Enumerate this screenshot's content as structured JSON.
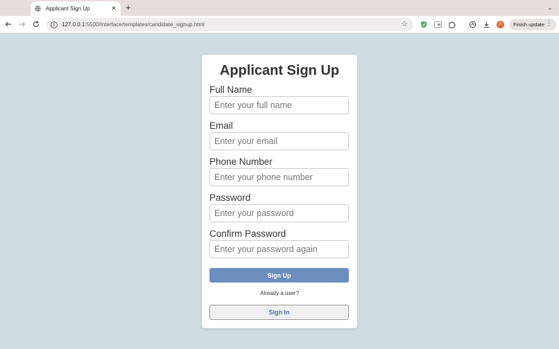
{
  "browser": {
    "tab": {
      "title": "Applicant Sign Up",
      "close": "✕"
    },
    "new_tab": "+",
    "tab_menu": "⌄",
    "url_host": "127.0.0.1",
    "url_path": ":5500/Interface/templates/candidate_signup.html",
    "avatar_letter": "A",
    "finish_update": "Finish update",
    "colors": {
      "tabstrip": "#e6dede",
      "page_bg": "#cfdde2",
      "avatar": "#e06b3d",
      "extension_shield": "#4caf6e"
    }
  },
  "form": {
    "title": "Applicant Sign Up",
    "fields": [
      {
        "label": "Full Name",
        "placeholder": "Enter your full name"
      },
      {
        "label": "Email",
        "placeholder": "Enter your email"
      },
      {
        "label": "Phone Number",
        "placeholder": "Enter your phone number"
      },
      {
        "label": "Password",
        "placeholder": "Enter your password"
      },
      {
        "label": "Confirm Password",
        "placeholder": "Enter your password again"
      }
    ],
    "submit_label": "Sign Up",
    "already_text": "Already a user?",
    "signin_label": "Sign In",
    "colors": {
      "primary": "#6c8ebf",
      "signin_text": "#4d6f9c"
    }
  }
}
